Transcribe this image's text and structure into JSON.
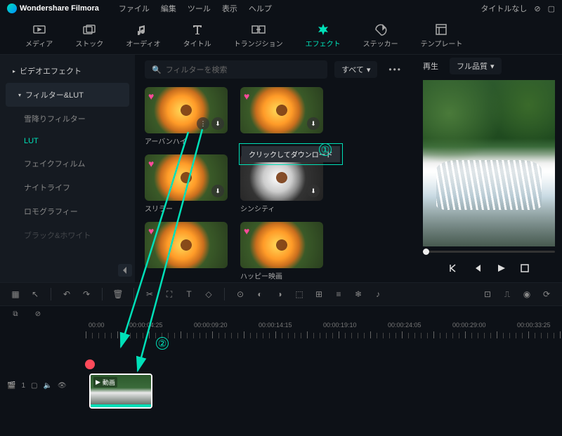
{
  "titlebar": {
    "app_name": "Wondershare Filmora",
    "doc_title": "タイトルなし"
  },
  "menubar": {
    "file": "ファイル",
    "edit": "編集",
    "tool": "ツール",
    "view": "表示",
    "help": "ヘルプ"
  },
  "tabs": {
    "media": "メディア",
    "stock": "ストック",
    "audio": "オーディオ",
    "title": "タイトル",
    "transition": "トランジション",
    "effect": "エフェクト",
    "sticker": "ステッカー",
    "template": "テンプレート"
  },
  "sidebar": {
    "video_effect": "ビデオエフェクト",
    "filter_lut": "フィルター&LUT",
    "items": {
      "snow": "雪降りフィルター",
      "lut": "LUT",
      "fake": "フェイクフィルム",
      "night": "ナイトライフ",
      "lomo": "ロモグラフィー",
      "bw": "ブラック&ホワイト"
    }
  },
  "search": {
    "placeholder": "フィルターを検索",
    "all": "すべて"
  },
  "thumbs": {
    "urban": "アーバンハイ",
    "slide": "スリラー",
    "sincity": "シンシティ",
    "happy": "ハッピー映画"
  },
  "tooltip": {
    "text": "クリックしてダウンロード",
    "num1": "①",
    "num2": "②"
  },
  "preview": {
    "play_label": "再生",
    "quality": "フル品質"
  },
  "timeline": {
    "marks": [
      "00:00",
      "00:00:04:25",
      "00:00:09:20",
      "00:00:14:15",
      "00:00:19:10",
      "00:00:24:05",
      "00:00:29:00",
      "00:00:33:25"
    ],
    "clip_label": "動画",
    "track_id": "1"
  }
}
